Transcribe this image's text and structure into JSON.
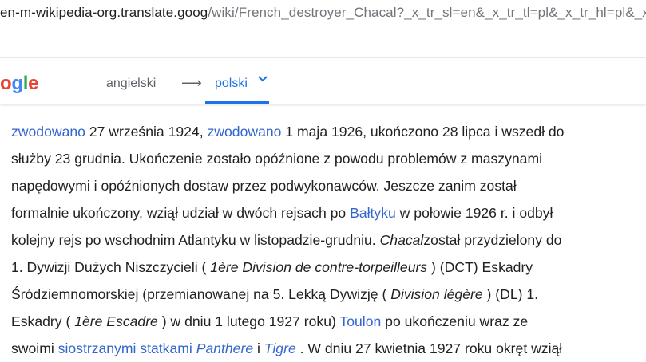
{
  "address_bar": {
    "host": "en-m-wikipedia-org.translate.goog",
    "path": "/wiki/French_destroyer_Chacal?_x_tr_sl=en&_x_tr_tl=pl&_x_tr_hl=pl&_x_"
  },
  "translate_bar": {
    "logo_parts": [
      "o",
      "g",
      "l",
      "e"
    ],
    "source_language": "angielski",
    "arrow": "⟶",
    "target_language": "polski",
    "colors": {
      "accent": "#1a73e8",
      "link": "#3366cc"
    }
  },
  "article": {
    "lines": [
      [
        {
          "t": "zwodowano",
          "link": true
        },
        {
          "t": " 27 września 1924, "
        },
        {
          "t": "zwodowano",
          "link": true
        },
        {
          "t": " 1 maja 1926, ukończono 28 lipca i wszedł do"
        }
      ],
      [
        {
          "t": "służby 23 grudnia. Ukończenie zostało opóźnione z powodu problemów z maszynami"
        }
      ],
      [
        {
          "t": "napędowymi i opóźnionych dostaw przez podwykonawców. Jeszcze zanim został"
        }
      ],
      [
        {
          "t": "formalnie ukończony, wziął udział w dwóch rejsach po "
        },
        {
          "t": "Bałtyku",
          "link": true
        },
        {
          "t": " w połowie 1926 r. i odbył"
        }
      ],
      [
        {
          "t": "kolejny rejs po wschodnim Atlantyku w listopadzie-grudniu. "
        },
        {
          "t": "Chacal",
          "italic": true
        },
        {
          "t": "został przydzielony do"
        }
      ],
      [
        {
          "t": "1. Dywizji Dużych Niszczycieli ( "
        },
        {
          "t": "1ère Division de contre-torpeilleurs",
          "italic": true
        },
        {
          "t": " ) (DCT) Eskadry"
        }
      ],
      [
        {
          "t": "Śródziemnomorskiej (przemianowanej na 5. Lekką Dywizję ( "
        },
        {
          "t": "Division légère",
          "italic": true
        },
        {
          "t": " ) (DL) 1."
        }
      ],
      [
        {
          "t": "Eskadry ( "
        },
        {
          "t": "1ère Escadre",
          "italic": true
        },
        {
          "t": " ) w dniu 1 lutego 1927 roku) "
        },
        {
          "t": "Toulon",
          "link": true
        },
        {
          "t": " po ukończeniu wraz ze"
        }
      ],
      [
        {
          "t": "swoimi "
        },
        {
          "t": "siostrzanymi statkami",
          "link": true
        },
        {
          "t": " "
        },
        {
          "t": "Panthere",
          "link": true,
          "italic": true
        },
        {
          "t": " i "
        },
        {
          "t": "Tigre",
          "link": true,
          "italic": true
        },
        {
          "t": " . W dniu 27 kwietnia 1927 roku okręt wziął"
        }
      ]
    ]
  }
}
